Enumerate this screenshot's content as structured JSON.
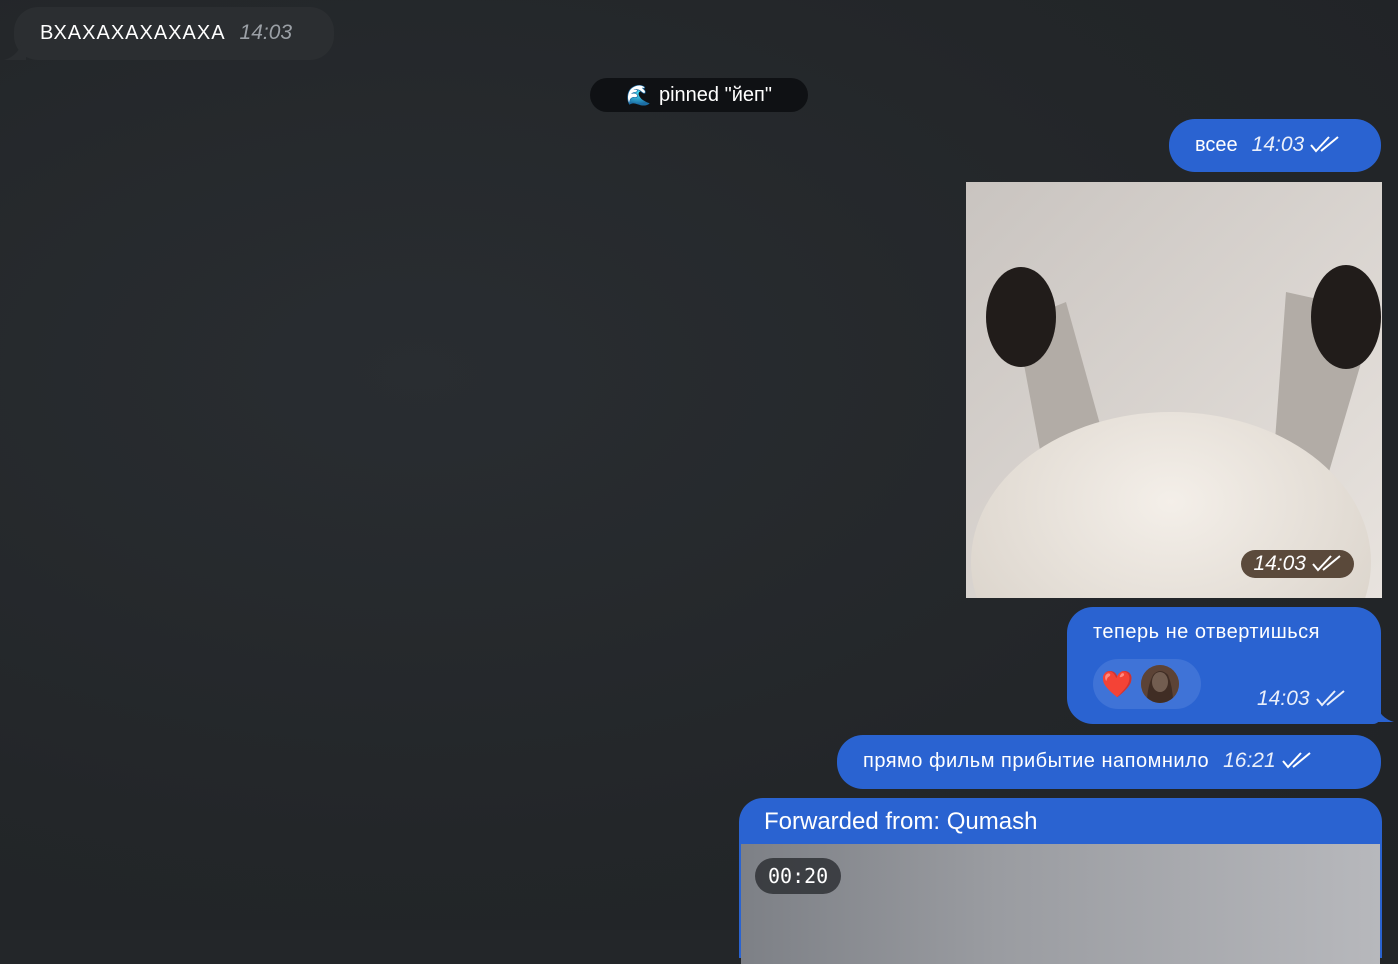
{
  "messages": {
    "incoming_1": {
      "text": "ВХАХАХАХАХАХА",
      "time": "14:03"
    },
    "pin_notice": {
      "emoji": "🌊",
      "prefix": "pinned",
      "quoted": "\"йеп\""
    },
    "out_1": {
      "text": "всее",
      "time": "14:03"
    },
    "out_photo": {
      "time": "14:03"
    },
    "out_2": {
      "text": "теперь не отвертишься",
      "time": "14:03",
      "reaction": "❤️"
    },
    "out_3": {
      "text": "прямо фильм прибытие напомнило",
      "time": "16:21"
    },
    "forwarded": {
      "label": "Forwarded from:",
      "source": "Qumash",
      "duration": "00:20"
    }
  },
  "colors": {
    "outgoing": "#2a63d1",
    "incoming": "#2b2e31",
    "background": "#232629"
  }
}
